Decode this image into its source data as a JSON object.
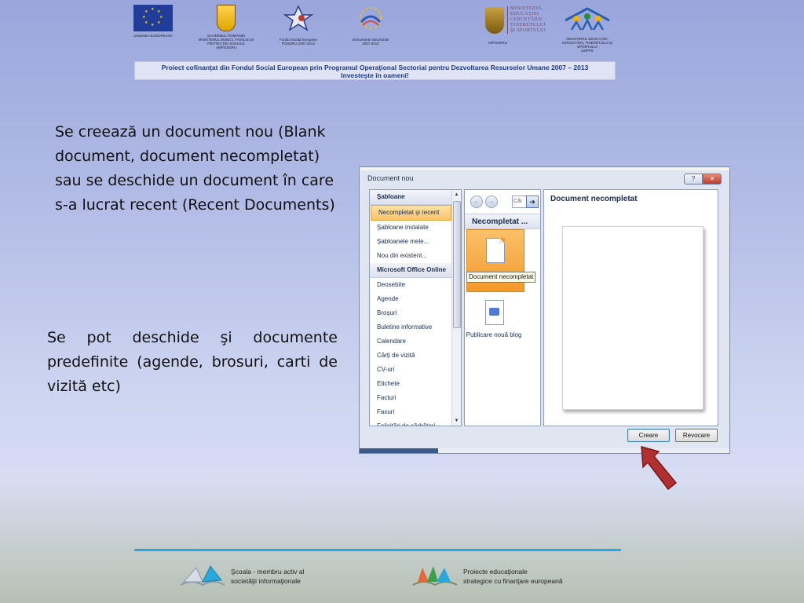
{
  "header": {
    "logos": [
      {
        "id": "eu",
        "caption": "UNIUNEA EUROPEANĂ"
      },
      {
        "id": "gov",
        "caption": "GUVERNUL ROMÂNIEI\nMINISTERUL MUNCII, FAMILIEI ŞI PROTECŢIEI SOCIALE\nAMPOSDRU"
      },
      {
        "id": "fse",
        "caption": "Fondul Social European\nPOSDRU 2007-2013"
      },
      {
        "id": "is",
        "caption": "Instrumente Structurale\n2007-2013"
      },
      {
        "id": "oiposdru",
        "caption": "OIPOSDRU"
      },
      {
        "id": "umpfe",
        "caption": "MINISTERUL EDUCAŢIEI, CERCETĂRII, TINERETULUI ŞI SPORTULUI\nUMPFE"
      }
    ],
    "ministry_text": [
      "MINISTERUL",
      "EDUCAŢIEI",
      "CERCETĂRII",
      "TINERETULUI",
      "ŞI SPORTULUI"
    ],
    "banner_line1": "Proiect cofinanţat din Fondul Social European prin Programul Operaţional Sectorial pentru Dezvoltarea Resurselor Umane 2007 – 2013",
    "banner_line2": "Investeşte în oameni!"
  },
  "slide": {
    "text1": "Se creează un document nou (Blank document, document necompletat) sau se deschide un document în care s-a lucrat recent (Recent Documents)",
    "text2": "Se pot deschide şi documente predefinite (agende, brosuri, carti de vizită etc)"
  },
  "dialog": {
    "title": "Document nou",
    "help_glyph": "?",
    "close_glyph": "×",
    "left_items": [
      {
        "label": "Şabloane",
        "kind": "head"
      },
      {
        "label": "Necompletat şi recent",
        "kind": "selected"
      },
      {
        "label": "Şabloane instalate",
        "kind": "item"
      },
      {
        "label": "Şabloanele mele...",
        "kind": "item"
      },
      {
        "label": "Nou din existent...",
        "kind": "item"
      },
      {
        "label": "Microsoft Office Online",
        "kind": "head"
      },
      {
        "label": "Deosebite",
        "kind": "item"
      },
      {
        "label": "Agende",
        "kind": "item"
      },
      {
        "label": "Broşuri",
        "kind": "item"
      },
      {
        "label": "Buletine informative",
        "kind": "item"
      },
      {
        "label": "Calendare",
        "kind": "item"
      },
      {
        "label": "Cărţi de vizită",
        "kind": "item"
      },
      {
        "label": "CV-uri",
        "kind": "item"
      },
      {
        "label": "Etichete",
        "kind": "item"
      },
      {
        "label": "Facturi",
        "kind": "item"
      },
      {
        "label": "Faxuri",
        "kind": "item"
      },
      {
        "label": "Felicitări de sărbători",
        "kind": "item"
      }
    ],
    "search_text": "Căi",
    "middle_header": "Necompletat ...",
    "tooltip": "Document necompletat",
    "blog_label": "Publicare nouă blog",
    "preview_title": "Document necompletat",
    "create_label": "Creare",
    "cancel_label": "Revocare"
  },
  "footer": {
    "left_line1": "Şcoala - membru activ al",
    "left_line2": "societăţii informaţionale",
    "right_line1": "Proiecte educaţionale",
    "right_line2": "strategice cu finanţare europeană"
  },
  "colors": {
    "footer_line": "#29a8dc",
    "banner_text": "#1d3a8a",
    "arrow": "#b03030"
  }
}
